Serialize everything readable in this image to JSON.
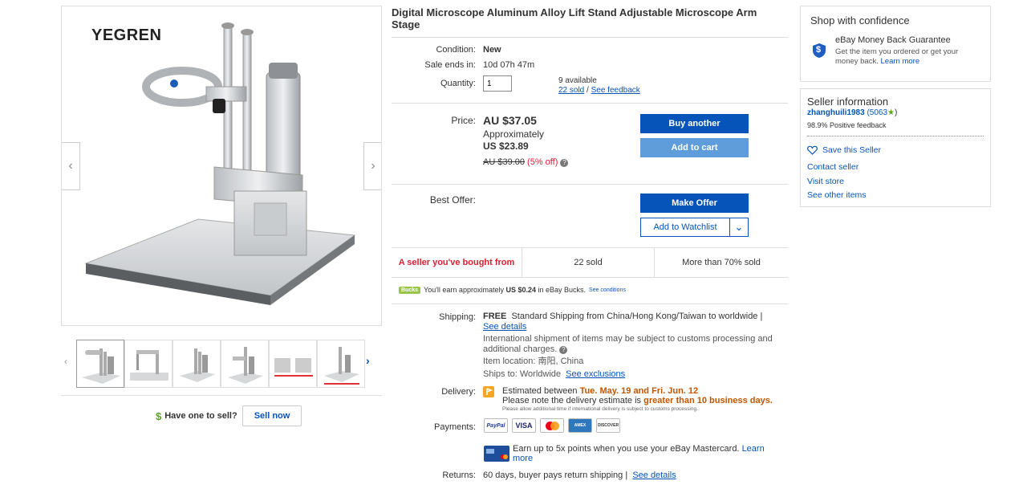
{
  "gallery": {
    "brand": "YEGREN",
    "prev_arrow": "‹",
    "next_arrow": "›",
    "thumb_prev": "‹",
    "thumb_next": "›"
  },
  "sell": {
    "dollar": "$",
    "question": "Have one to sell?",
    "button": "Sell now"
  },
  "item": {
    "title": "Digital Microscope Aluminum Alloy Lift Stand Adjustable Microscope Arm Stage",
    "condition_label": "Condition:",
    "condition_value": "New",
    "sale_ends_label": "Sale ends in:",
    "sale_ends_value": "10d 07h 47m",
    "quantity_label": "Quantity:",
    "quantity_value": "1",
    "available": "9 available",
    "sold_link": "22 sold",
    "separator": " / ",
    "feedback_link": "See feedback"
  },
  "price": {
    "label": "Price:",
    "main": "AU $37.05",
    "approx_label": "Approximately",
    "approx_value": "US $23.89",
    "original": "AU $39.00",
    "discount": "(5% off)",
    "info_icon": "?",
    "buy_button": "Buy another",
    "cart_button": "Add to cart"
  },
  "offer": {
    "label": "Best Offer:",
    "make_offer": "Make Offer",
    "watchlist": "Add to Watchlist",
    "watchlist_caret": "⌄"
  },
  "seller_strip": {
    "bought_from": "A seller you've bought from",
    "sold": "22 sold",
    "percent": "More than 70% sold"
  },
  "bucks": {
    "badge": "Bucks",
    "text_pre": "You'll earn approximately ",
    "amount": "US $0.24",
    "text_post": " in eBay Bucks.",
    "conditions": "See conditions"
  },
  "shipping": {
    "label": "Shipping:",
    "free": "FREE",
    "method": "Standard Shipping from China/Hong Kong/Taiwan to worldwide |",
    "details_link": "See details",
    "customs": "International shipment of items may be subject to customs processing and additional charges.",
    "info_icon": "?",
    "location": "Item location: 南阳, China",
    "ships_to": "Ships to: Worldwide",
    "exclusions_link": "See exclusions"
  },
  "delivery": {
    "label": "Delivery:",
    "estimated_pre": "Estimated between ",
    "estimated_dates": "Tue. May. 19 and Fri. Jun. 12",
    "note_pre": "Please note the delivery estimate is ",
    "note_emph": "greater than 10 business days.",
    "fine_print": "Please allow additional time if international delivery is subject to customs processing."
  },
  "payments": {
    "label": "Payments:",
    "cards": [
      "PayPal",
      "VISA",
      "MC",
      "AMEX",
      "DISCOVER"
    ],
    "mastercard_text": "Earn up to 5x points when you use your eBay Mastercard.",
    "learn_more_link": "Learn more"
  },
  "returns": {
    "label": "Returns:",
    "text": "60 days, buyer pays return shipping |",
    "details_link": "See details"
  },
  "confidence": {
    "title": "Shop with confidence",
    "guarantee_title": "eBay Money Back Guarantee",
    "guarantee_text": "Get the item you ordered or get your money back.",
    "learn_more": "Learn more",
    "shield_glyph": "$"
  },
  "seller_info": {
    "title": "Seller information",
    "username": "zhanghuili1983",
    "score": "(5063",
    "score_close": ")",
    "feedback": "98.9% Positive feedback",
    "save": "Save this Seller",
    "contact": "Contact seller",
    "store": "Visit store",
    "other": "See other items"
  },
  "colors": {
    "link": "#0654ba",
    "primary_button": "#0654ba",
    "cart_button": "#5e9dd9",
    "highlight_red": "#dd1e31",
    "delivery_orange": "#c45500",
    "star_green": "#5ba71b"
  }
}
